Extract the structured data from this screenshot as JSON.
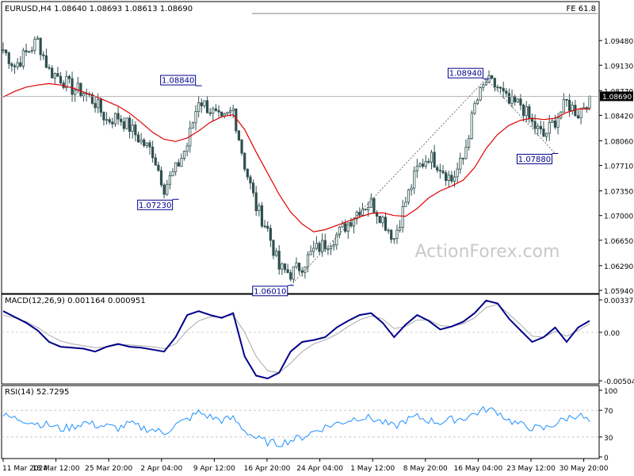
{
  "window": {
    "header_text": "EURUSD,H4  1.08640 1.08693 1.08613 1.08690",
    "fe_label": "FE 61.8",
    "watermark": "ActionForex.com"
  },
  "colors": {
    "candle": "#2f4f4f",
    "ma": "#e00000",
    "macd": "#00008b",
    "signal": "#a9a9a9",
    "rsi": "#1e90ff",
    "grid": "#c0c0c0",
    "label_border": "#00008b"
  },
  "chart_data": [
    {
      "type": "candlestick",
      "panel": "price",
      "symbol": "EURUSD",
      "timeframe": "H4",
      "ohlc_last": {
        "open": 1.0864,
        "high": 1.08693,
        "low": 1.08613,
        "close": 1.0869
      },
      "y_ticks": [
        "1.09480",
        "1.09130",
        "1.08770",
        "1.08420",
        "1.08060",
        "1.07710",
        "1.07350",
        "1.07000",
        "1.06650",
        "1.06290",
        "1.05940"
      ],
      "ylim": [
        1.0594,
        1.0965
      ],
      "current_price_label": "1.08690",
      "current_price": 1.0869,
      "annotations": [
        {
          "label": "1.08840",
          "value": 1.0884,
          "date": "3 Apr 2024"
        },
        {
          "label": "1.07230",
          "value": 1.0723,
          "date": "2 Apr 2024"
        },
        {
          "label": "1.06010",
          "value": 1.0601,
          "date": "16 Apr 2024"
        },
        {
          "label": "1.08940",
          "value": 1.0894,
          "date": "16 May 2024"
        },
        {
          "label": "1.07880",
          "value": 1.0788,
          "date": "30 May 2024"
        }
      ],
      "x_ticks": [
        "11 Mar 2024",
        "18 Mar 12:00",
        "25 Mar 20:00",
        "2 Apr 04:00",
        "9 Apr 12:00",
        "16 Apr 20:00",
        "24 Apr 04:00",
        "1 May 12:00",
        "8 May 20:00",
        "16 May 04:00",
        "23 May 12:00",
        "30 May 20:00"
      ],
      "ma_series_values": [
        1.0868,
        1.0876,
        1.0882,
        1.0885,
        1.0887,
        1.0885,
        1.0881,
        1.0875,
        1.0869,
        1.0862,
        1.0855,
        1.0845,
        1.0832,
        1.0818,
        1.0808,
        1.0805,
        1.081,
        1.082,
        1.0832,
        1.084,
        1.0843,
        1.0822,
        1.079,
        1.076,
        1.073,
        1.0705,
        1.0688,
        1.0677,
        1.068,
        1.0686,
        1.0692,
        1.0698,
        1.0703,
        1.0704,
        1.07,
        1.0699,
        1.071,
        1.0725,
        1.0735,
        1.0742,
        1.075,
        1.0768,
        1.0795,
        1.0815,
        1.0828,
        1.0835,
        1.0838,
        1.0836,
        1.0838,
        1.0846,
        1.0851,
        1.0851
      ],
      "close_series_values": [
        1.0935,
        1.0912,
        1.093,
        1.0948,
        1.0905,
        1.0895,
        1.088,
        1.0875,
        1.086,
        1.0835,
        1.084,
        1.0825,
        1.0805,
        1.079,
        1.074,
        1.0765,
        1.08,
        1.0865,
        1.085,
        1.0832,
        1.085,
        1.0772,
        1.0712,
        1.068,
        1.0625,
        1.0618,
        1.063,
        1.065,
        1.066,
        1.0672,
        1.069,
        1.071,
        1.0718,
        1.0695,
        1.0668,
        1.072,
        1.0765,
        1.0785,
        1.077,
        1.075,
        1.078,
        1.0855,
        1.089,
        1.0882,
        1.0858,
        1.0858,
        1.083,
        1.0812,
        1.0835,
        1.086,
        1.0845,
        1.0869
      ]
    },
    {
      "type": "line",
      "panel": "macd",
      "title": "MACD(12,26,9) 0.001164 0.000951",
      "macd": 0.001164,
      "signal": 0.000951,
      "y_ticks": [
        "0.003375",
        "0.00",
        "-0.00504"
      ],
      "ylim": [
        -0.00504,
        0.003375
      ],
      "macd_values": [
        0.0022,
        0.0016,
        0.001,
        0.0002,
        -0.001,
        -0.0015,
        -0.0016,
        -0.0017,
        -0.002,
        -0.0015,
        -0.0012,
        -0.0015,
        -0.0016,
        -0.0018,
        -0.002,
        -0.0005,
        0.0018,
        0.0022,
        0.0018,
        0.0015,
        0.002,
        -0.0025,
        -0.0045,
        -0.0048,
        -0.0042,
        -0.002,
        -0.001,
        -0.0008,
        -0.0005,
        0.0005,
        0.0012,
        0.0018,
        0.002,
        0.001,
        -0.0005,
        0.0008,
        0.0018,
        0.0012,
        0.0003,
        0.0006,
        0.0011,
        0.002,
        0.0033,
        0.003,
        0.0014,
        0.0002,
        -0.001,
        -0.0005,
        0.0005,
        -0.001,
        0.0005,
        0.0012
      ],
      "signal_values": [
        0.0018,
        0.0015,
        0.0011,
        0.0005,
        -0.0003,
        -0.0009,
        -0.0012,
        -0.0014,
        -0.0016,
        -0.0015,
        -0.0013,
        -0.0013,
        -0.0014,
        -0.0015,
        -0.0017,
        -0.0012,
        0.0002,
        0.0012,
        0.0016,
        0.0016,
        0.0018,
        0.0,
        -0.0025,
        -0.004,
        -0.0042,
        -0.0032,
        -0.002,
        -0.0012,
        -0.0008,
        -0.0002,
        0.0006,
        0.0013,
        0.0017,
        0.0014,
        0.0004,
        0.0006,
        0.0013,
        0.0013,
        0.0007,
        0.0006,
        0.0009,
        0.0015,
        0.0026,
        0.0029,
        0.0019,
        0.0008,
        -0.0004,
        -0.0005,
        0.0001,
        -0.0004,
        0.0002,
        0.0009
      ]
    },
    {
      "type": "line",
      "panel": "rsi",
      "title": "RSI(14) 52.7295",
      "rsi": 52.7295,
      "y_ticks": [
        "100",
        "70",
        "30",
        "0"
      ],
      "levels": [
        70,
        30
      ],
      "ylim": [
        0,
        100
      ],
      "rsi_values": [
        62,
        58,
        55,
        50,
        48,
        42,
        45,
        52,
        48,
        46,
        43,
        50,
        44,
        41,
        36,
        48,
        56,
        67,
        60,
        55,
        58,
        40,
        28,
        22,
        20,
        25,
        30,
        38,
        45,
        50,
        55,
        60,
        58,
        52,
        45,
        55,
        60,
        55,
        52,
        56,
        58,
        65,
        72,
        68,
        55,
        48,
        44,
        42,
        50,
        58,
        64,
        52.7
      ]
    }
  ]
}
